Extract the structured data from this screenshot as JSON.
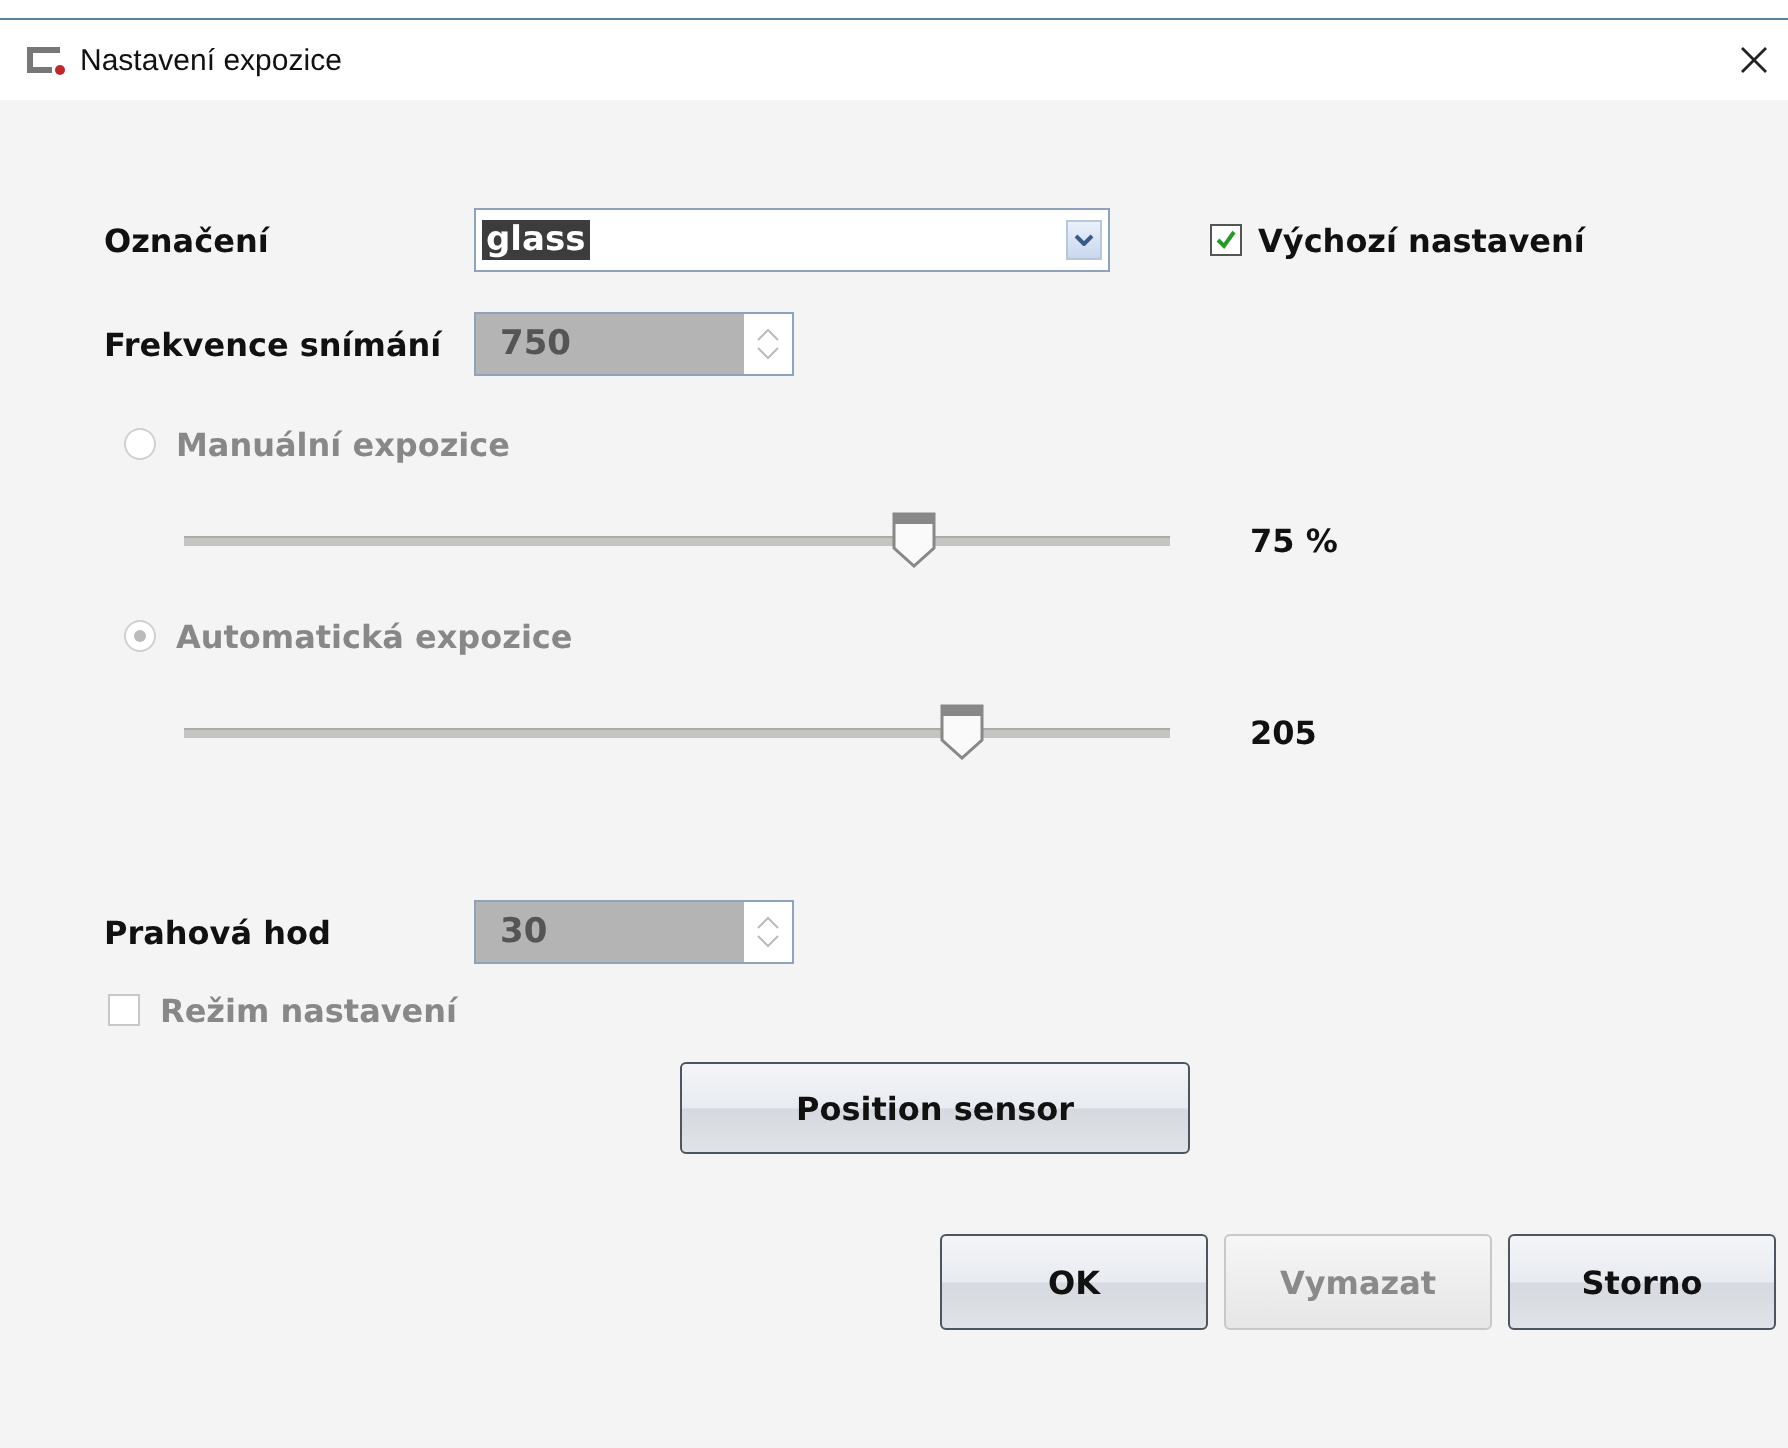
{
  "window": {
    "title": "Nastavení expozice"
  },
  "designation": {
    "label": "Označení",
    "value": "glass",
    "text_selected": true
  },
  "default_settings": {
    "label": "Výchozí nastavení",
    "checked": true
  },
  "frequency": {
    "label": "Frekvence snímání",
    "value": "750",
    "disabled": true
  },
  "exposure_modes": [
    {
      "label": "Manuální expozice",
      "selected": false,
      "disabled": true,
      "level": 0.74,
      "reading": "75 %"
    },
    {
      "label": "Automatická expozice",
      "selected": true,
      "disabled": true,
      "level": 0.79,
      "reading": "205"
    }
  ],
  "threshold": {
    "label": "Prahová hod",
    "value": "30",
    "disabled": true
  },
  "setup_mode": {
    "label": "Režim nastavení",
    "checked": false,
    "disabled": true
  },
  "position_button": {
    "label": "Position sensor"
  },
  "buttons": [
    {
      "label": "OK",
      "disabled": false
    },
    {
      "label": "Vymazat",
      "disabled": true
    },
    {
      "label": "Storno",
      "disabled": false
    }
  ]
}
